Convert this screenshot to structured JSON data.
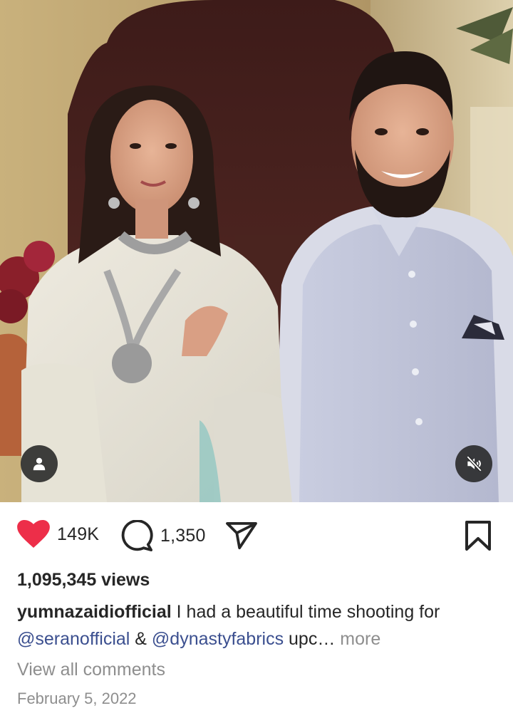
{
  "post": {
    "media": {
      "description_icon_tags": "person-tag-icon",
      "description_icon_mute": "speaker-muted-icon"
    },
    "actions": {
      "likes": "149K",
      "comments": "1,350"
    },
    "views": "1,095,345 views",
    "caption": {
      "username": "yumnazaidiofficial",
      "text_1": " I had a beautiful time shooting for ",
      "mention_1": "@seranofficial",
      "text_2": " & ",
      "mention_2": "@dynastyfabrics",
      "text_3": " upc…",
      "more": " more"
    },
    "view_all_comments": "View all comments",
    "date": "February 5, 2022"
  },
  "colors": {
    "like": "#ed2e49",
    "mention": "#3b4f8f",
    "muted_text": "#8e8e8e",
    "text": "#262626"
  }
}
